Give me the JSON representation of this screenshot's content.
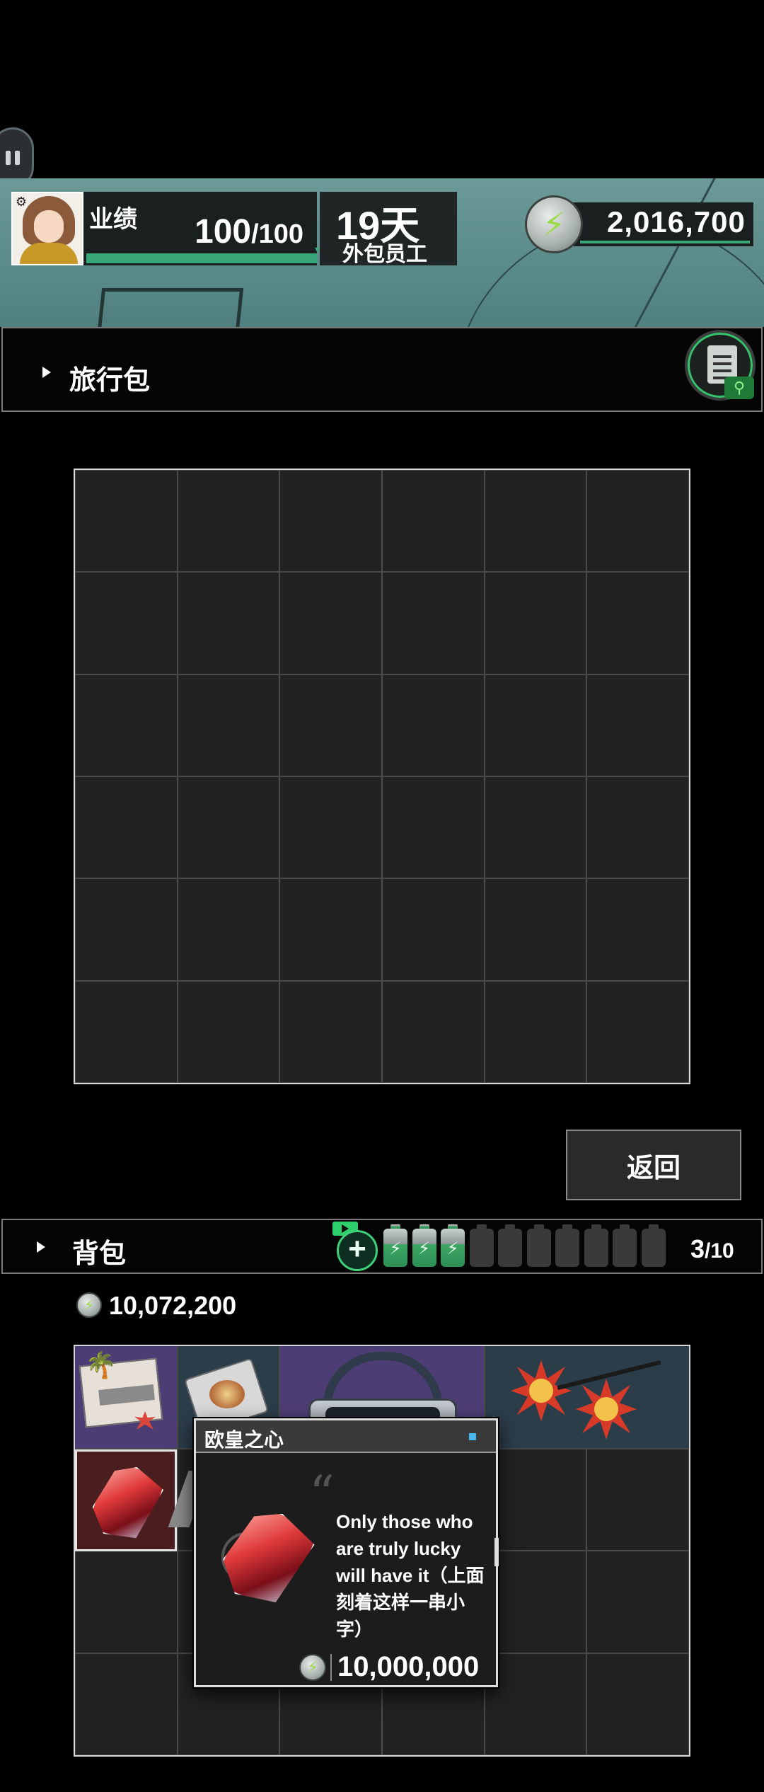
{
  "hud": {
    "performance_label": "业绩",
    "performance_value": "100",
    "performance_max": "/100",
    "performance_fill": 1.0,
    "days_value": "19天",
    "role_label": "外包员工",
    "money": "2,016,700",
    "coin_icon": "lightning-coin-icon"
  },
  "travel_bag": {
    "title": "旅行包",
    "rows": 6,
    "cols": 6,
    "search_icon": "clipboard-search-icon"
  },
  "back_button": {
    "label": "返回"
  },
  "backpack": {
    "title": "背包",
    "capacity_used": "3",
    "capacity_max": "/10",
    "battery_full_count": 3,
    "battery_total": 10,
    "money": "10,072,200",
    "rows": 4,
    "cols": 6,
    "items": [
      {
        "name": "ticket-item",
        "icon": "ticket-icon"
      },
      {
        "name": "plate-item",
        "icon": "plate-icon"
      },
      {
        "name": "vr-headset-item",
        "icon": "vr-headset-icon"
      },
      {
        "name": "sun-glasses-item",
        "icon": "sun-glasses-icon"
      },
      {
        "name": "crystal-item",
        "icon": "crystal-icon"
      }
    ]
  },
  "tooltip": {
    "title": "欧皇之心",
    "description": "Only those who are truly lucky will have it（上面刻着这样一串小字）",
    "price": "10,000,000"
  },
  "colors": {
    "accent_green": "#3aa77a",
    "tooltip_dot": "#4ab6f0",
    "item_purple": "#4d3d75",
    "item_slate": "#2c3d4a"
  }
}
